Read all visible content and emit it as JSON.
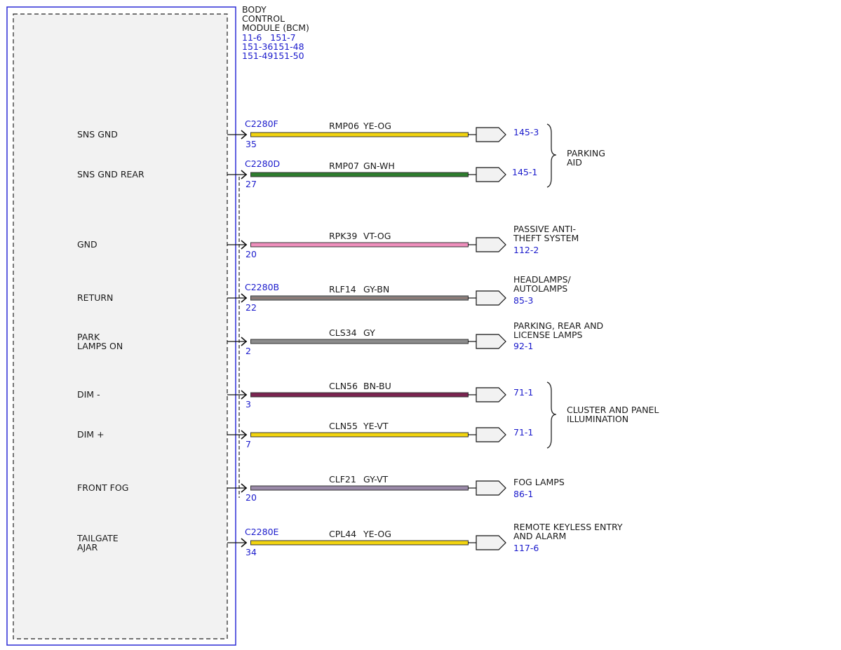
{
  "module": {
    "name_lines": [
      "BODY",
      "CONTROL",
      "MODULE (BCM)"
    ],
    "ref_lines": [
      "11-6   151-7",
      "151-36151-48",
      "151-49151-50"
    ]
  },
  "circuits": [
    {
      "pin_label": [
        "SNS GND"
      ],
      "connector": "C2280F",
      "pin": "35",
      "circuit": "RMP06",
      "color_code": "YE-OG",
      "colors": [
        "#f2d40f",
        "#f2d40f"
      ],
      "ref": "145-3"
    },
    {
      "pin_label": [
        "SNS GND REAR"
      ],
      "connector": "C2280D",
      "pin": "27",
      "circuit": "RMP07",
      "color_code": "GN-WH",
      "colors": [
        "#2e7d2e",
        "#2e7d2e"
      ],
      "ref": "145-1"
    },
    {
      "pin_label": [
        "GND"
      ],
      "connector": "",
      "pin": "20",
      "circuit": "RPK39",
      "color_code": "VT-OG",
      "colors": [
        "#ee8fbc",
        "#ee8fbc"
      ],
      "ref": "112-2"
    },
    {
      "pin_label": [
        "RETURN"
      ],
      "connector": "C2280B",
      "pin": "22",
      "circuit": "RLF14",
      "color_code": "GY-BN",
      "colors": [
        "#8a8a8a",
        "#8e5a4a"
      ],
      "ref": "85-3"
    },
    {
      "pin_label": [
        "PARK",
        "LAMPS ON"
      ],
      "connector": "",
      "pin": "2",
      "circuit": "CLS34",
      "color_code": "GY",
      "colors": [
        "#8c8c8c",
        "#8c8c8c"
      ],
      "ref": "92-1"
    },
    {
      "pin_label": [
        "DIM -"
      ],
      "connector": "",
      "pin": "3",
      "circuit": "CLN56",
      "color_code": "BN-BU",
      "colors": [
        "#7a2450",
        "#7a2450"
      ],
      "ref": "71-1"
    },
    {
      "pin_label": [
        "DIM +"
      ],
      "connector": "",
      "pin": "7",
      "circuit": "CLN55",
      "color_code": "YE-VT",
      "colors": [
        "#f2d40f",
        "#f2d40f"
      ],
      "ref": "71-1"
    },
    {
      "pin_label": [
        "FRONT FOG"
      ],
      "connector": "",
      "pin": "20",
      "circuit": "CLF21",
      "color_code": "GY-VT",
      "colors": [
        "#9a8aa8",
        "#9a8aa8"
      ],
      "ref": "86-1"
    },
    {
      "pin_label": [
        "TAILGATE",
        "AJAR"
      ],
      "connector": "C2280E",
      "pin": "34",
      "circuit": "CPL44",
      "color_code": "YE-OG",
      "colors": [
        "#f2d40f",
        "#f2d40f"
      ],
      "ref": "117-6"
    }
  ],
  "destinations": [
    {
      "lines": [
        "PARKING",
        "AID"
      ],
      "ref": ""
    },
    {
      "lines": [
        "PASSIVE ANTI-",
        "THEFT SYSTEM"
      ],
      "ref": "112-2"
    },
    {
      "lines": [
        "HEADLAMPS/",
        "AUTOLAMPS"
      ],
      "ref": "85-3"
    },
    {
      "lines": [
        "PARKING, REAR AND",
        "LICENSE LAMPS"
      ],
      "ref": "92-1"
    },
    {
      "lines": [
        "CLUSTER AND PANEL",
        "ILLUMINATION"
      ],
      "ref": ""
    },
    {
      "lines": [
        "FOG LAMPS"
      ],
      "ref": "86-1"
    },
    {
      "lines": [
        "REMOTE KEYLESS ENTRY",
        "AND ALARM"
      ],
      "ref": "117-6"
    }
  ]
}
